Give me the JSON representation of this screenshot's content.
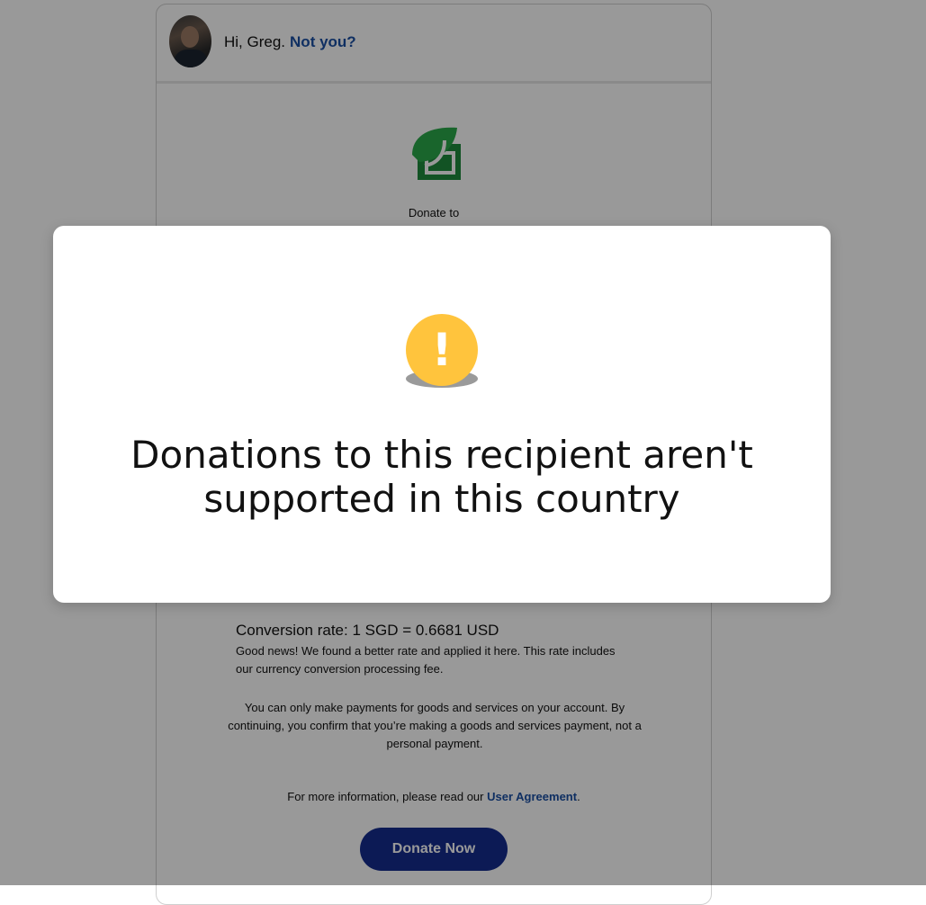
{
  "header": {
    "greeting": "Hi, Greg.",
    "not_you_link": "Not you?"
  },
  "recipient": {
    "donate_to_label": "Donate to",
    "logo_icon": "leaf-logo-icon",
    "logo_color": "#1f8a3c"
  },
  "conversion": {
    "rate_text": "Conversion rate: 1 SGD = 0.6681 USD",
    "good_news": "Good news! We found a better rate and applied it here. This rate includes our currency conversion processing fee."
  },
  "notices": {
    "goods_services": "You can only make payments for goods and services on your account. By continuing, you confirm that you’re making a goods and services payment, not a personal payment.",
    "more_info_prefix": "For more information, please read our",
    "user_agreement_link": "User Agreement",
    "more_info_suffix": "."
  },
  "actions": {
    "donate_now_label": "Donate Now"
  },
  "modal": {
    "icon": "warning-icon",
    "icon_glyph": "!",
    "icon_color": "#ffc43d",
    "title": "Donations to this recipient aren't supported in this country"
  },
  "colors": {
    "link": "#1a4fa3",
    "button": "#142c8e"
  }
}
